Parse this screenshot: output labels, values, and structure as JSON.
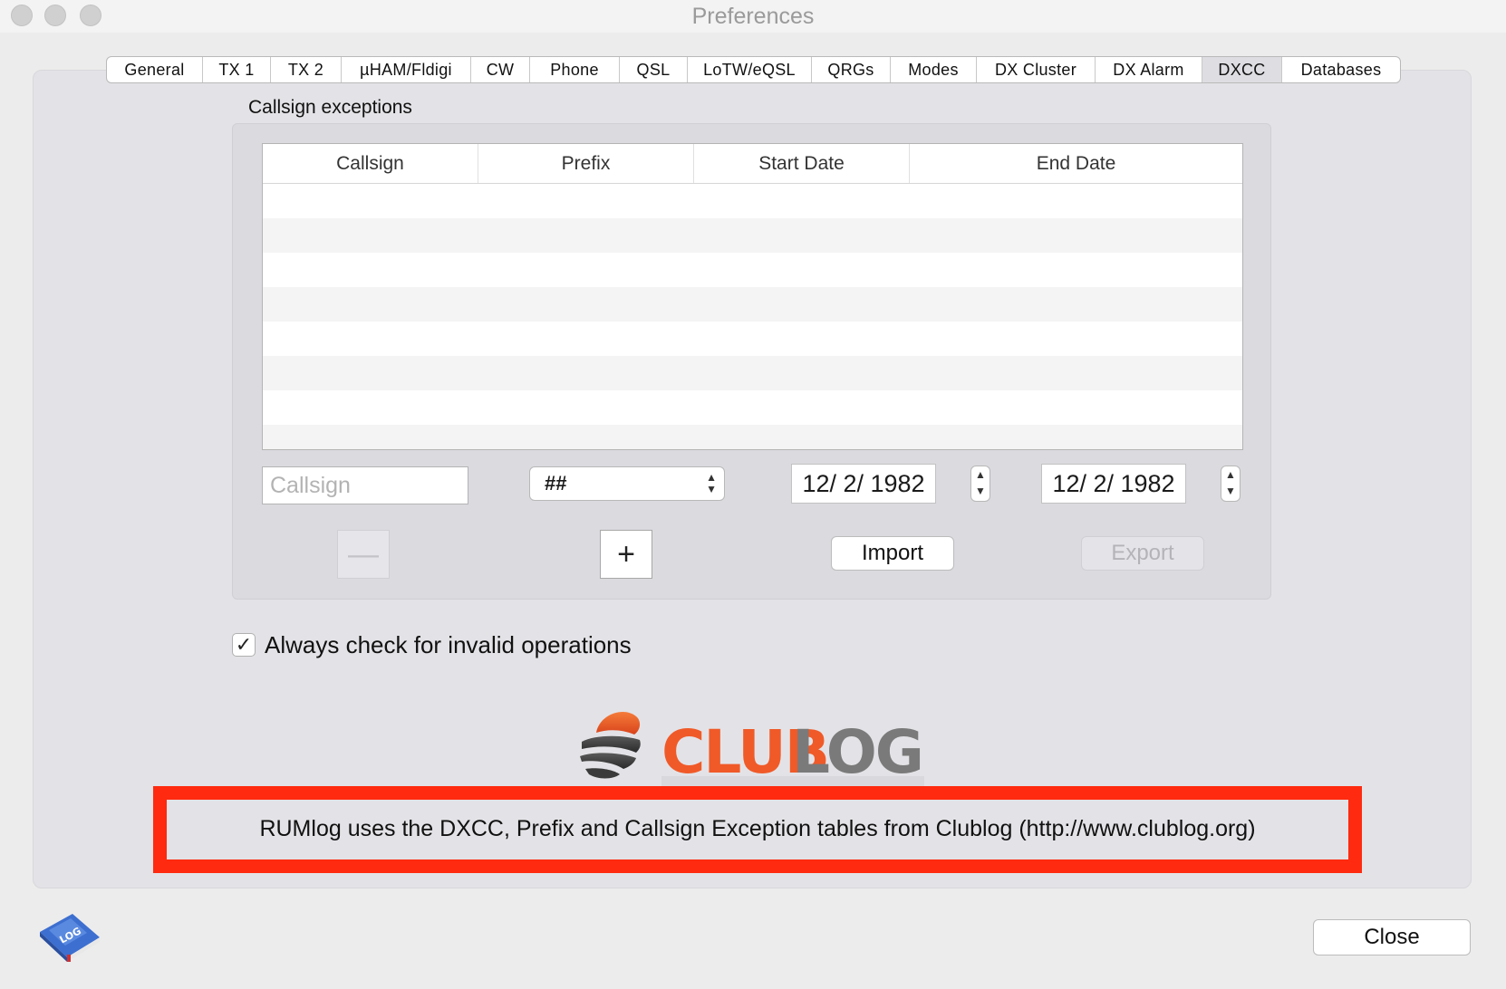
{
  "window": {
    "title": "Preferences",
    "buttons": [
      "close-icon",
      "minimize-icon",
      "zoom-icon"
    ]
  },
  "tabs": [
    {
      "label": "General",
      "active": false
    },
    {
      "label": "TX 1",
      "active": false
    },
    {
      "label": "TX 2",
      "active": false
    },
    {
      "label": "µHAM/Fldigi",
      "active": false
    },
    {
      "label": "CW",
      "active": false
    },
    {
      "label": "Phone",
      "active": false
    },
    {
      "label": "QSL",
      "active": false
    },
    {
      "label": "LoTW/eQSL",
      "active": false
    },
    {
      "label": "QRGs",
      "active": false
    },
    {
      "label": "Modes",
      "active": false
    },
    {
      "label": "DX Cluster",
      "active": false
    },
    {
      "label": "DX Alarm",
      "active": false
    },
    {
      "label": "DXCC",
      "active": true
    },
    {
      "label": "Databases",
      "active": false
    }
  ],
  "exceptions": {
    "group_label": "Callsign exceptions",
    "columns": [
      "Callsign",
      "Prefix",
      "Start Date",
      "End Date"
    ],
    "rows": [],
    "callsign_input": {
      "value": "",
      "placeholder": "Callsign"
    },
    "prefix_select": {
      "value": "##"
    },
    "start_date": "12/  2/ 1982",
    "end_date": "12/  2/ 1982",
    "remove_label": "—",
    "add_label": "+",
    "import_label": "Import",
    "export_label": "Export"
  },
  "invalid_ops": {
    "checked": true,
    "label": "Always check for invalid operations"
  },
  "clublog": {
    "logo_text_part1": "CLUB",
    "logo_text_part2": "LOG",
    "notice": "RUMlog uses the DXCC, Prefix and Callsign Exception tables from Clublog (http://www.clublog.org)"
  },
  "footer": {
    "app_icon_text": "LOG",
    "close_label": "Close"
  },
  "colors": {
    "highlight": "#ff2a0f",
    "clublog_orange": "#f05a28",
    "clublog_gray": "#7a7a7a"
  }
}
